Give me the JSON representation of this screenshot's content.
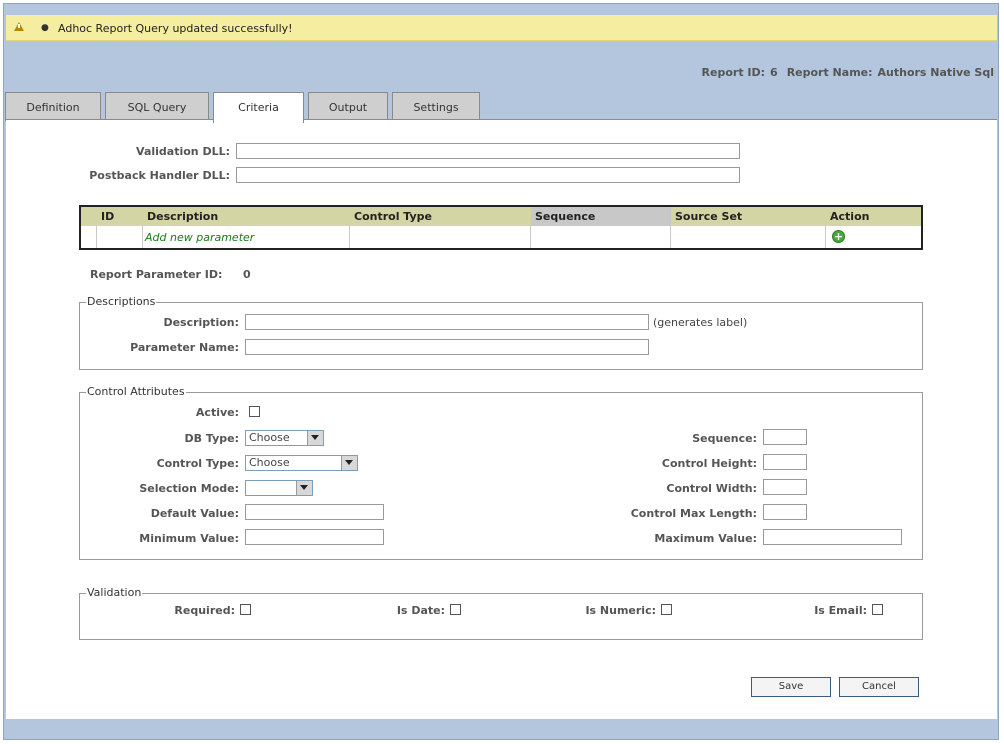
{
  "notice": {
    "message": "Adhoc Report Query updated successfully!",
    "bullet": "●",
    "icon": "warning-icon"
  },
  "report": {
    "id_label": "Report ID:",
    "id_value": "6",
    "name_label": "Report Name:",
    "name_value": "Authors Native Sql"
  },
  "tabs": [
    {
      "label": "Definition"
    },
    {
      "label": "SQL Query"
    },
    {
      "label": "Criteria"
    },
    {
      "label": "Output"
    },
    {
      "label": "Settings"
    }
  ],
  "active_tab": "Criteria",
  "dll": {
    "validation_label": "Validation DLL:",
    "validation_value": "",
    "postback_label": "Postback Handler DLL:",
    "postback_value": ""
  },
  "grid": {
    "columns": [
      "ID",
      "Description",
      "Control Type",
      "Sequence",
      "Source Set",
      "Action"
    ],
    "sorted_column": "Sequence",
    "add_link": "Add new parameter",
    "add_icon": "add-circle-icon"
  },
  "report_parameter": {
    "label": "Report Parameter ID:",
    "value": "0"
  },
  "descriptions": {
    "legend": "Descriptions",
    "description_label": "Description:",
    "description_value": "",
    "description_hint": "(generates label)",
    "param_name_label": "Parameter Name:",
    "param_name_value": ""
  },
  "control_attributes": {
    "legend": "Control Attributes",
    "active_label": "Active:",
    "db_type_label": "DB Type:",
    "db_type_value": "Choose",
    "control_type_label": "Control Type:",
    "control_type_value": "Choose",
    "selection_mode_label": "Selection Mode:",
    "selection_mode_value": "",
    "default_value_label": "Default Value:",
    "minimum_value_label": "Minimum Value:",
    "sequence_label": "Sequence:",
    "control_height_label": "Control Height:",
    "control_width_label": "Control Width:",
    "control_max_length_label": "Control Max Length:",
    "maximum_value_label": "Maximum Value:"
  },
  "validation": {
    "legend": "Validation",
    "required_label": "Required:",
    "is_date_label": "Is Date:",
    "is_numeric_label": "Is Numeric:",
    "is_email_label": "Is Email:"
  },
  "buttons": {
    "save": "Save",
    "cancel": "Cancel"
  },
  "colors": {
    "frame": "#b3c6dd",
    "notice": "#f5eda0",
    "grid_header": "#d4d5a4",
    "add_link": "#1a7a1a"
  }
}
